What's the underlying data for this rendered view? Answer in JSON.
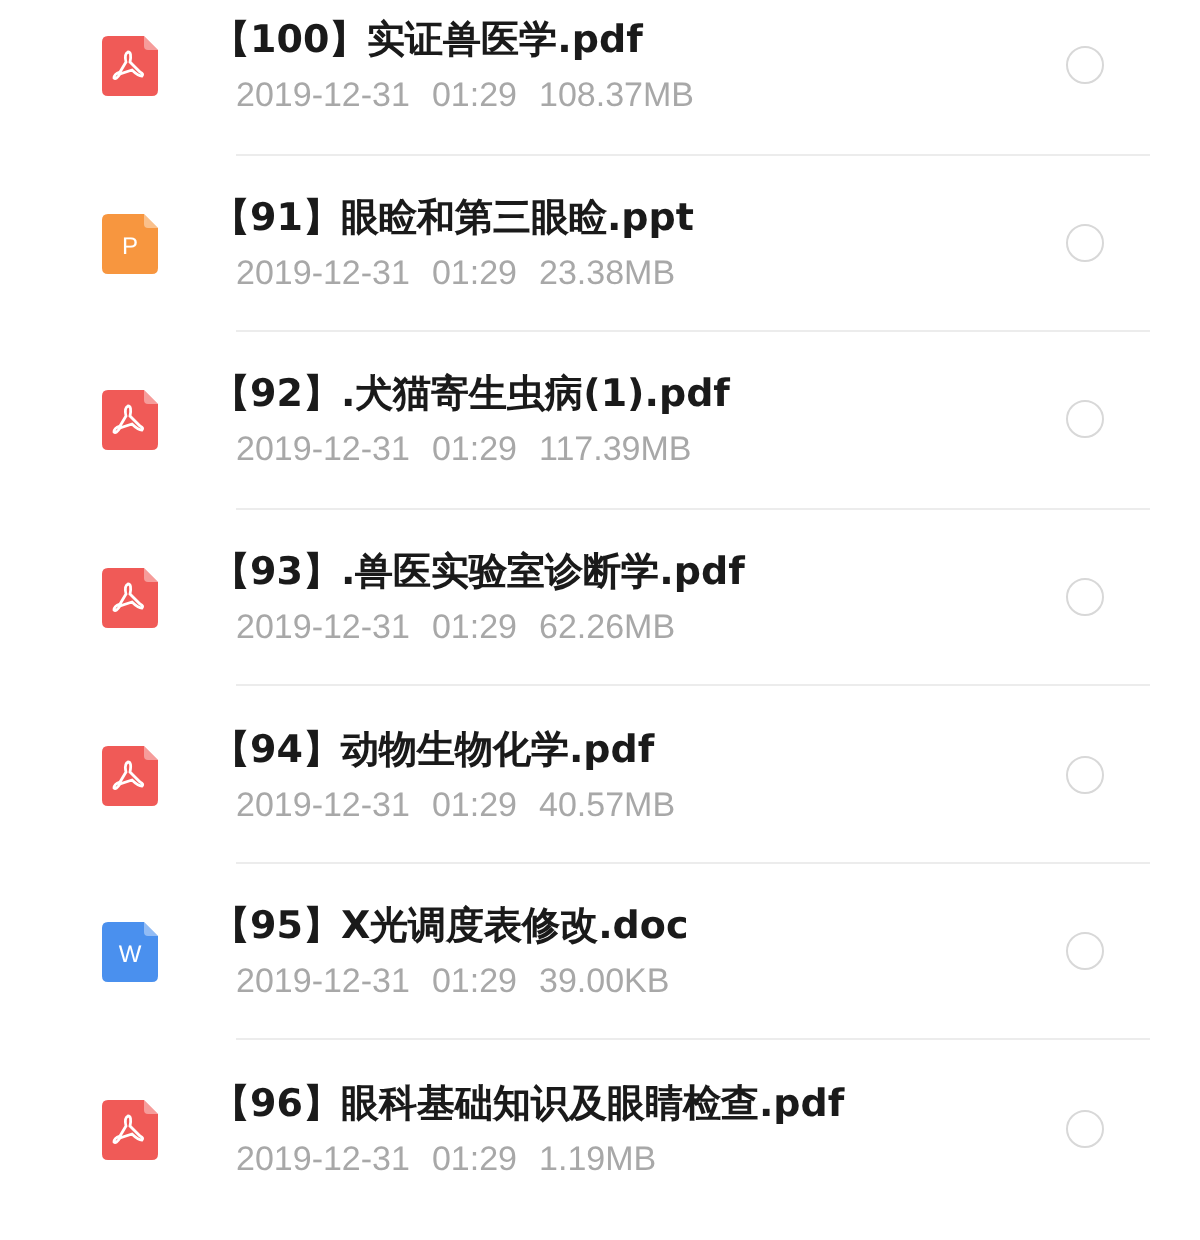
{
  "files": [
    {
      "kind": "pdf",
      "name": "【100】实证兽医学.pdf",
      "date": "2019-12-31",
      "time": "01:29",
      "size": "108.37MB",
      "selected": false
    },
    {
      "kind": "ppt",
      "icon_letter": "P",
      "name": "【91】眼睑和第三眼睑.ppt",
      "date": "2019-12-31",
      "time": "01:29",
      "size": "23.38MB",
      "selected": false
    },
    {
      "kind": "pdf",
      "name": "【92】.犬猫寄生虫病(1).pdf",
      "date": "2019-12-31",
      "time": "01:29",
      "size": "117.39MB",
      "selected": false
    },
    {
      "kind": "pdf",
      "name": "【93】.兽医实验室诊断学.pdf",
      "date": "2019-12-31",
      "time": "01:29",
      "size": "62.26MB",
      "selected": false
    },
    {
      "kind": "pdf",
      "name": "【94】动物生物化学.pdf",
      "date": "2019-12-31",
      "time": "01:29",
      "size": "40.57MB",
      "selected": false
    },
    {
      "kind": "doc",
      "icon_letter": "W",
      "name": "【95】X光调度表修改.doc",
      "date": "2019-12-31",
      "time": "01:29",
      "size": "39.00KB",
      "selected": false
    },
    {
      "kind": "pdf",
      "name": "【96】眼科基础知识及眼睛检查.pdf",
      "date": "2019-12-31",
      "time": "01:29",
      "size": "1.19MB",
      "selected": false
    }
  ]
}
